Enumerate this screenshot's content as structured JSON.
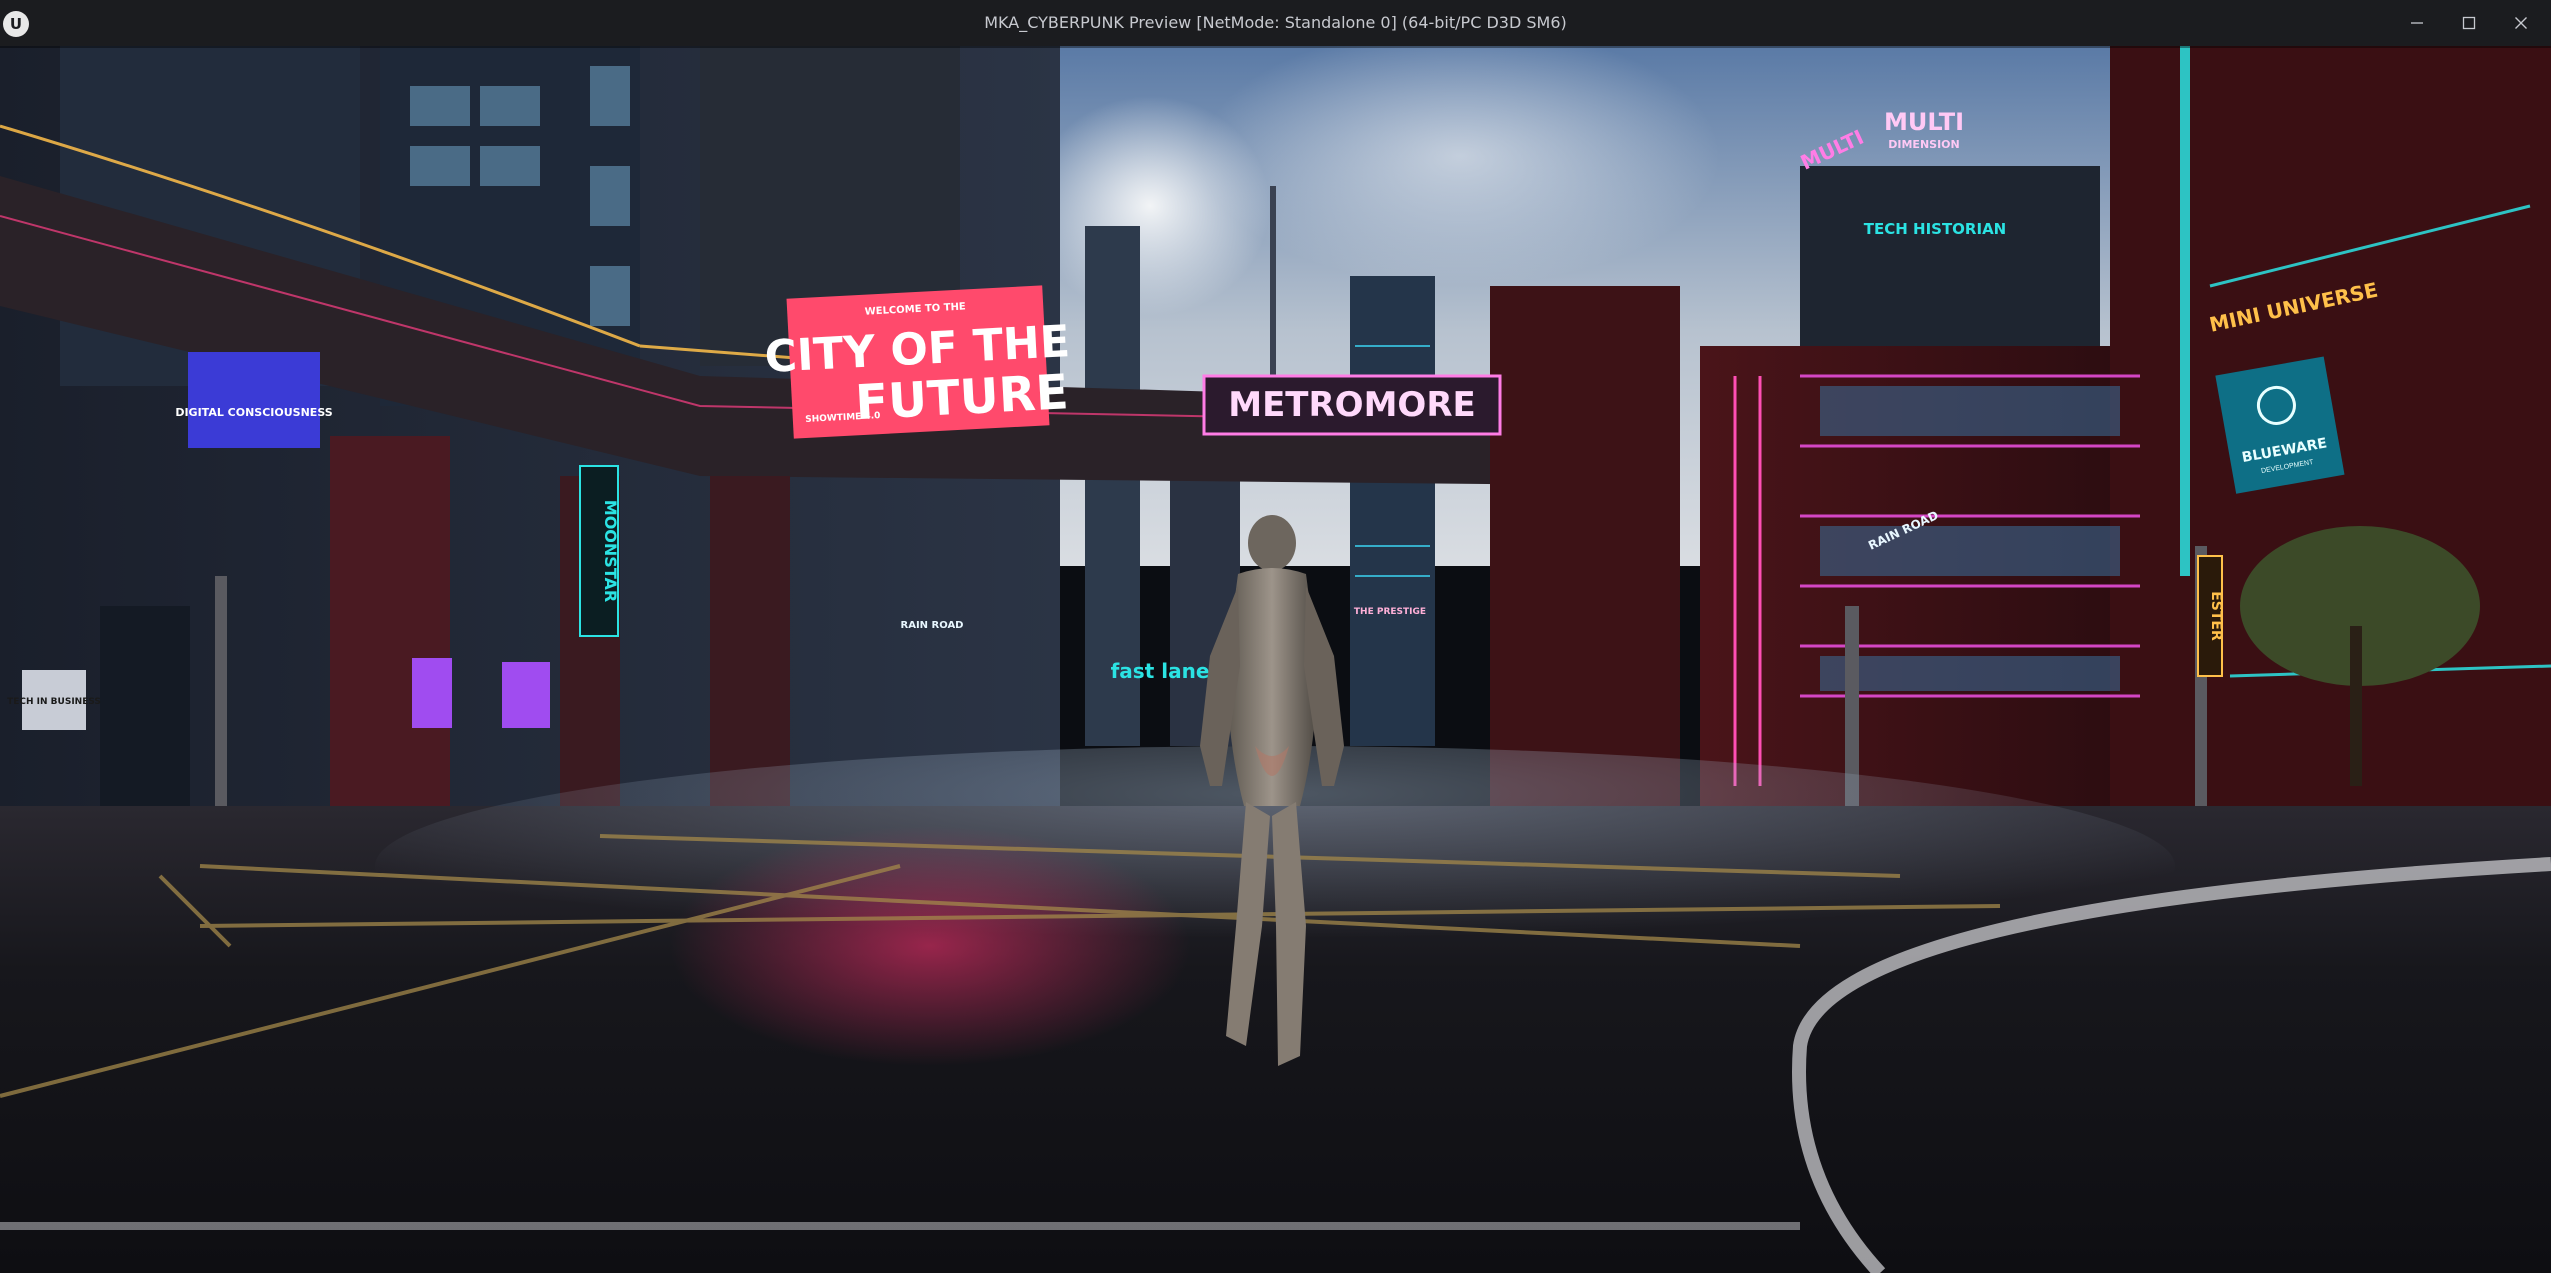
{
  "window": {
    "app_icon_glyph": "U",
    "title": "MKA_CYBERPUNK Preview [NetMode: Standalone 0]  (64-bit/PC D3D SM6)",
    "controls": {
      "minimize_icon": "minimize-icon",
      "maximize_icon": "maximize-icon",
      "close_icon": "close-icon"
    }
  },
  "scene": {
    "billboard_city": {
      "small": "WELCOME TO THE",
      "line1": "CITY OF THE",
      "line2": "FUTURE",
      "footer": "SHOWTIME 4.0"
    },
    "bridge_sign": "METROMORE",
    "digital_sign": "DIGITAL CONSCIOUSNESS",
    "tech_sign": "TECH IN BUSINESS",
    "multi_sign_top": "MULTI",
    "multi_sign_bottom": "DIMENSION",
    "multi_sign_small": "MULTI",
    "tech_historian_sign": "TECH HISTORIAN",
    "mini_universe_sign": "MINI UNIVERSE",
    "blueware_sign": "BLUEWARE",
    "blueware_sub": "DEVELOPMENT",
    "fastlane_sign": "fast lane",
    "rain_road_sign": "RAIN ROAD",
    "rain_road_sign2": "RAIN ROAD",
    "vertical_sign_left": "MOONSTAR",
    "vertical_sign_right": "ESTER",
    "the_prestige_sign": "THE PRESTIGE"
  },
  "colors": {
    "title_bar": "#1b1c1f",
    "neon_pink": "#ff3f86",
    "neon_cyan": "#2be3e3",
    "neon_magenta": "#e64dd8",
    "neon_amber": "#ffc04a",
    "sky_blue": "#6f8fb8"
  }
}
